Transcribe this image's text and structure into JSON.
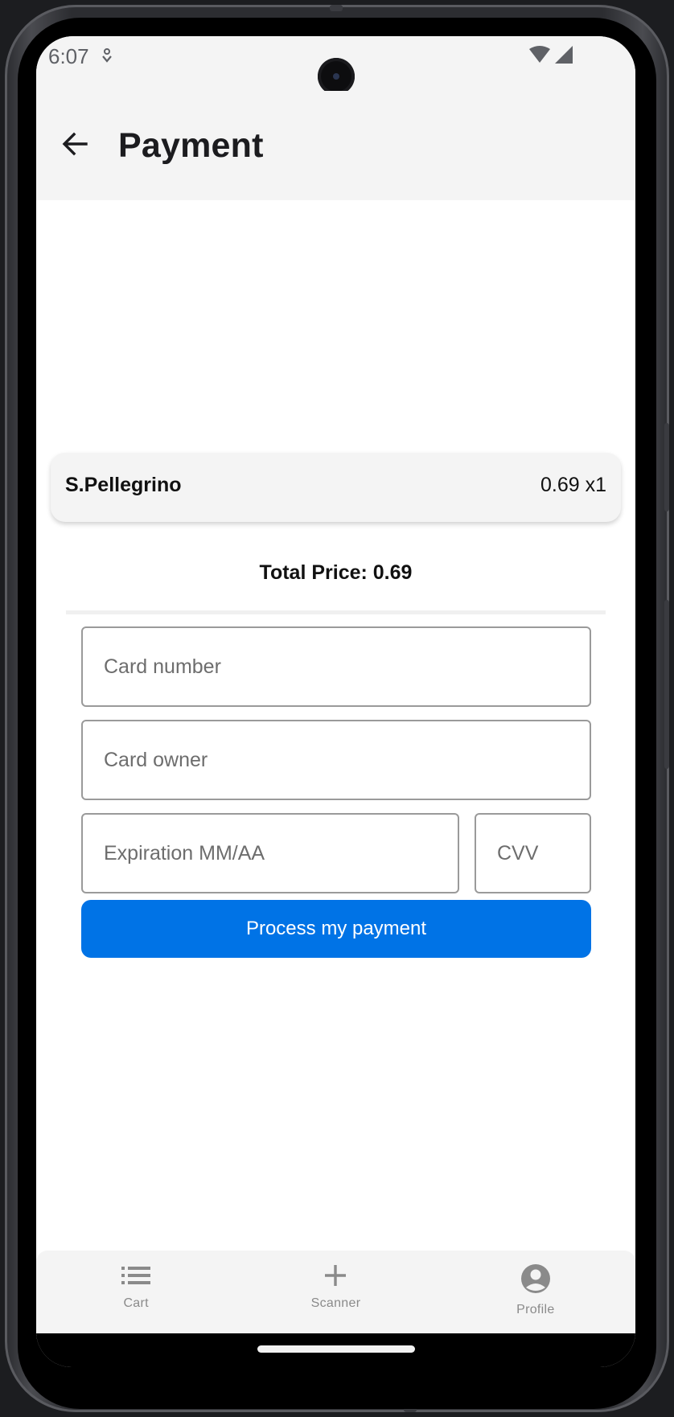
{
  "status_bar": {
    "time": "6:07"
  },
  "app_bar": {
    "title": "Payment"
  },
  "cart": {
    "items": [
      {
        "name": "S.Pellegrino",
        "price_qty": "0.69 x1"
      }
    ],
    "total_text": "Total Price: 0.69"
  },
  "form": {
    "card_number_placeholder": "Card number",
    "card_owner_placeholder": "Card owner",
    "expiration_placeholder": "Expiration MM/AA",
    "cvv_placeholder": "CVV",
    "submit_label": "Process my payment"
  },
  "bottom_nav": {
    "items": [
      {
        "label": "Cart",
        "icon": "list-icon"
      },
      {
        "label": "Scanner",
        "icon": "plus-icon"
      },
      {
        "label": "Profile",
        "icon": "account-circle-icon"
      }
    ]
  },
  "colors": {
    "accent": "#0073e6",
    "bar_background": "#f4f4f4",
    "nav_inactive": "#8a8a8a"
  }
}
